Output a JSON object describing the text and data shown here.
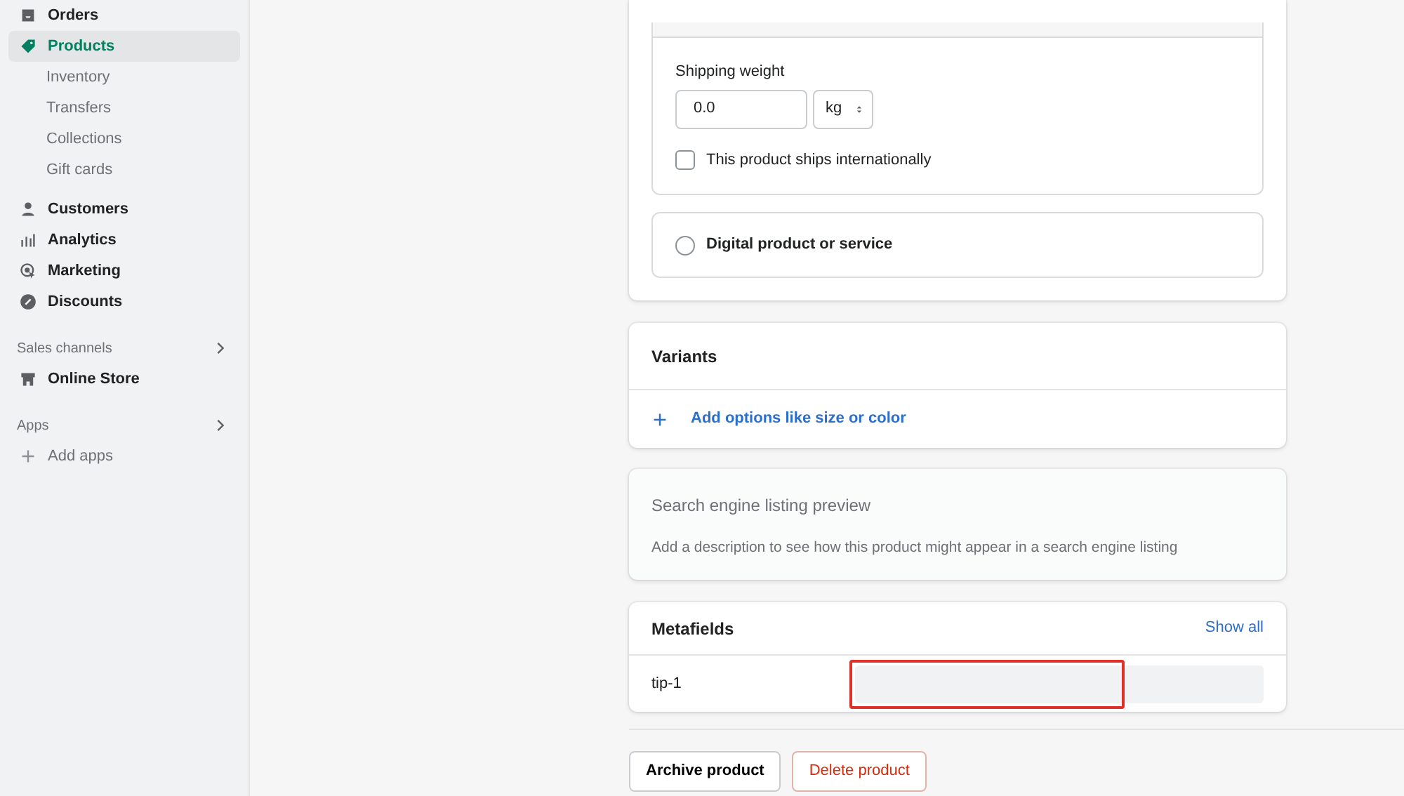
{
  "sidebar": {
    "items": [
      {
        "label": "Orders",
        "selected": false
      },
      {
        "label": "Products",
        "selected": true,
        "children": [
          {
            "label": "Inventory",
            "selected": false
          },
          {
            "label": "Transfers",
            "selected": false
          },
          {
            "label": "Collections",
            "selected": false
          },
          {
            "label": "Gift cards",
            "selected": false
          }
        ]
      },
      {
        "label": "Customers",
        "selected": false
      },
      {
        "label": "Analytics",
        "selected": false
      },
      {
        "label": "Marketing",
        "selected": false
      },
      {
        "label": "Discounts",
        "selected": false
      }
    ],
    "sections": [
      {
        "title": "Sales channels",
        "items": [
          {
            "label": "Online Store",
            "kind": "channel"
          }
        ]
      },
      {
        "title": "Apps",
        "items": [
          {
            "label": "Add apps",
            "kind": "add"
          }
        ]
      }
    ]
  },
  "shipping": {
    "weight_label": "Shipping weight",
    "weight_value": "0.0",
    "unit": "kg",
    "ships_internationally": {
      "label": "This product ships internationally",
      "checked": false
    }
  },
  "digital_option": {
    "label": "Digital product or service",
    "selected": false
  },
  "variants": {
    "title": "Variants",
    "add_action": "Add options like size or color"
  },
  "seo": {
    "title": "Search engine listing preview",
    "description": "Add a description to see how this product might appear in a search engine listing"
  },
  "metafields": {
    "title": "Metafields",
    "show_all": "Show all",
    "rows": [
      {
        "name": "tip-1",
        "highlighted": true
      }
    ]
  },
  "actions": [
    {
      "label": "Archive product",
      "kind": "secondary"
    },
    {
      "label": "Delete product",
      "kind": "destructive"
    }
  ]
}
